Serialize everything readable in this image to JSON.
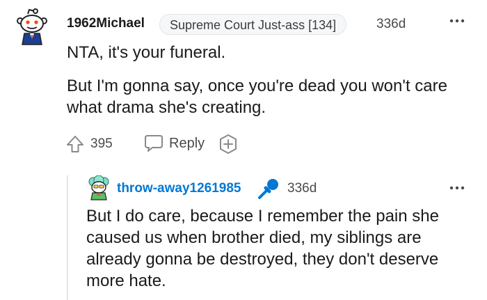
{
  "comment": {
    "username": "1962Michael",
    "flair": "Supreme Court Just-ass [134]",
    "age": "336d",
    "paragraphs": [
      "NTA, it's your funeral.",
      "But I'm gonna say, once you're dead you won't care what drama she's creating."
    ],
    "upvotes": "395",
    "reply_label": "Reply"
  },
  "reply": {
    "username": "throw-away1261985",
    "badge_icon": "microphone-icon",
    "age": "336d",
    "text": "But I do care, because I remember the pain she caused us when brother died, my siblings are already gonna be destroyed, they don't deserve more hate."
  },
  "colors": {
    "op_username": "#0079d3",
    "op_badge": "#0079d3",
    "text": "#1a1a1b",
    "meta": "#4a4a4a"
  }
}
